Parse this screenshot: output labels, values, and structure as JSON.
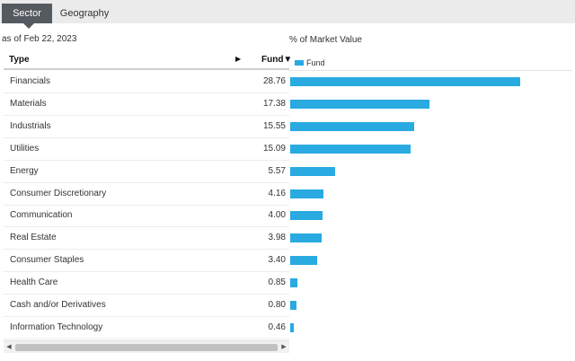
{
  "tabs": [
    {
      "label": "Sector",
      "active": true
    },
    {
      "label": "Geography",
      "active": false
    }
  ],
  "as_of": "as of Feb 22, 2023",
  "table": {
    "type_header": "Type",
    "sort_icon": "play-right-icon",
    "fund_header": "Fund▼"
  },
  "chart_title": "% of Market Value",
  "legend": {
    "label": "Fund",
    "color": "#29aae1"
  },
  "colors": {
    "bar": "#29aae1",
    "active_tab": "#555a60",
    "tab_bar": "#ebebeb"
  },
  "rows": [
    {
      "name": "Financials",
      "value": "28.76"
    },
    {
      "name": "Materials",
      "value": "17.38"
    },
    {
      "name": "Industrials",
      "value": "15.55"
    },
    {
      "name": "Utilities",
      "value": "15.09"
    },
    {
      "name": "Energy",
      "value": "5.57"
    },
    {
      "name": "Consumer Discretionary",
      "value": "4.16"
    },
    {
      "name": "Communication",
      "value": "4.00"
    },
    {
      "name": "Real Estate",
      "value": "3.98"
    },
    {
      "name": "Consumer Staples",
      "value": "3.40"
    },
    {
      "name": "Health Care",
      "value": "0.85"
    },
    {
      "name": "Cash and/or Derivatives",
      "value": "0.80"
    },
    {
      "name": "Information Technology",
      "value": "0.46"
    }
  ],
  "chart_data": {
    "type": "bar",
    "title": "% of Market Value",
    "categories": [
      "Financials",
      "Materials",
      "Industrials",
      "Utilities",
      "Energy",
      "Consumer Discretionary",
      "Communication",
      "Real Estate",
      "Consumer Staples",
      "Health Care",
      "Cash and/or Derivatives",
      "Information Technology"
    ],
    "series": [
      {
        "name": "Fund",
        "values": [
          28.76,
          17.38,
          15.55,
          15.09,
          5.57,
          4.16,
          4.0,
          3.98,
          3.4,
          0.85,
          0.8,
          0.46
        ]
      }
    ],
    "orientation": "horizontal",
    "legend": "top-left"
  }
}
